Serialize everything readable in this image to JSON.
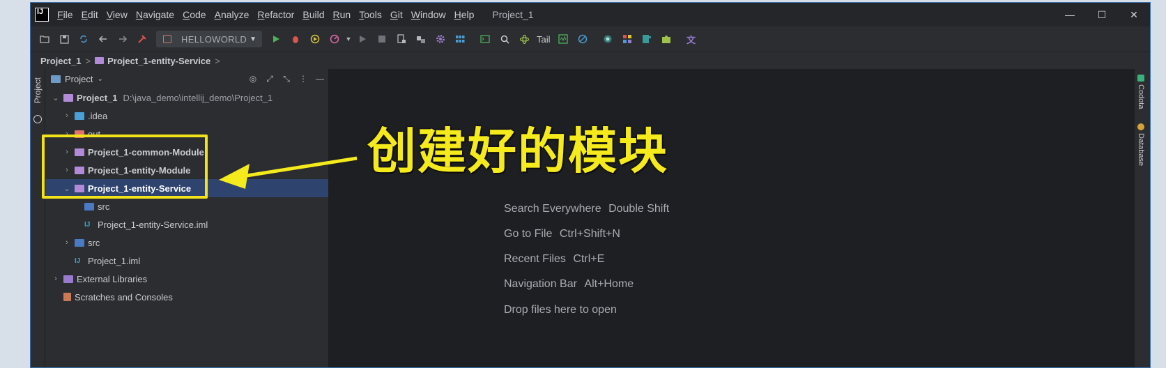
{
  "titlebar": {
    "menu": [
      "File",
      "Edit",
      "View",
      "Navigate",
      "Code",
      "Analyze",
      "Refactor",
      "Build",
      "Run",
      "Tools",
      "Git",
      "Window",
      "Help"
    ],
    "project_title": "Project_1",
    "controls": {
      "minimize": "—",
      "maximize": "☐",
      "close": "✕"
    }
  },
  "toolbar": {
    "run_config": "HELLOWORLD",
    "tail_label": "Tail"
  },
  "breadcrumb": {
    "items": [
      "Project_1",
      "Project_1-entity-Service"
    ],
    "separator": ">"
  },
  "left_strip": {
    "label": "Project"
  },
  "panel": {
    "title": "Project",
    "tree": [
      {
        "label": "Project_1",
        "path": "D:\\java_demo\\intellij_demo\\Project_1"
      },
      {
        "label": ".idea"
      },
      {
        "label": "out"
      },
      {
        "label": "Project_1-common-Module"
      },
      {
        "label": "Project_1-entity-Module"
      },
      {
        "label": "Project_1-entity-Service"
      },
      {
        "label": "src"
      },
      {
        "label": "Project_1-entity-Service.iml"
      },
      {
        "label": "src"
      },
      {
        "label": "Project_1.iml"
      },
      {
        "label": "External Libraries"
      },
      {
        "label": "Scratches and Consoles"
      }
    ]
  },
  "editor": {
    "hints": [
      {
        "action": "Search Everywhere",
        "key": "Double Shift"
      },
      {
        "action": "Go to File",
        "key": "Ctrl+Shift+N"
      },
      {
        "action": "Recent Files",
        "key": "Ctrl+E"
      },
      {
        "action": "Navigation Bar",
        "key": "Alt+Home"
      },
      {
        "action": "Drop files here to open",
        "key": ""
      }
    ]
  },
  "annotation": {
    "text": "创建好的模块",
    "color": "#f5ea1c"
  },
  "right_strip": {
    "items": [
      "Codota",
      "Database"
    ]
  }
}
